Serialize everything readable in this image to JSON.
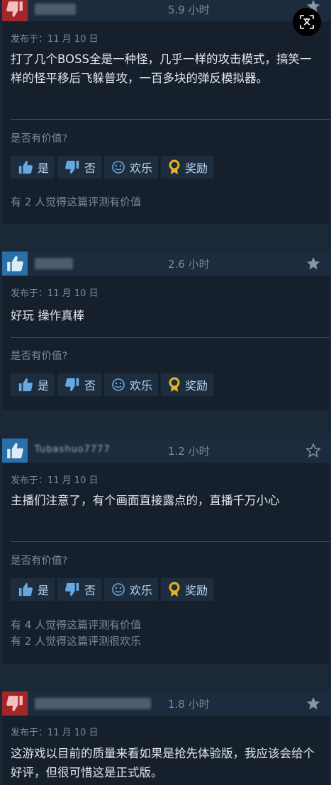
{
  "labels": {
    "helpful_question": "是否有价值?",
    "yes": "是",
    "no": "否",
    "funny": "欢乐",
    "award": "奖励"
  },
  "translate_button": {
    "icon": "translate-icon"
  },
  "reviews": [
    {
      "recommended": false,
      "hours": "5.9 小时",
      "posted": "发布于：11 月 10 日",
      "content": "打了几个BOSS全是一种怪，几乎一样的攻击模式，搞笑一样的怪平移后飞躲普攻，一百多块的弹反模拟器。",
      "helpful_count": "有 2 人觉得这篇评测有价值"
    },
    {
      "recommended": true,
      "hours": "2.6 小时",
      "posted": "发布于：11 月 10 日",
      "content": "好玩 操作真棒",
      "helpful_count": ""
    },
    {
      "recommended": true,
      "username": "Tubashuo7777",
      "hours": "1.2 小时",
      "posted": "发布于：11 月 10 日",
      "content": "主播们注意了，有个画面直接露点的，直播千万小心",
      "helpful_count": "有 4 人觉得这篇评测有价值",
      "funny_count": "有 2 人觉得这篇评测很欢乐"
    },
    {
      "recommended": false,
      "hours": "1.8 小时",
      "posted": "发布于：11 月 10 日",
      "content": "这游戏以目前的质量来看如果是抢先体验版，我应该会给个好评，但很可惜这是正式版。"
    }
  ],
  "colors": {
    "background": "#1b2838",
    "card": "#16202d",
    "header": "#1c2c3e",
    "thumb_down_bg": "#a2262a",
    "thumb_up_bg": "#2a6fa8",
    "vote_text": "#b8d5f0",
    "award_icon": "#e6b325"
  }
}
